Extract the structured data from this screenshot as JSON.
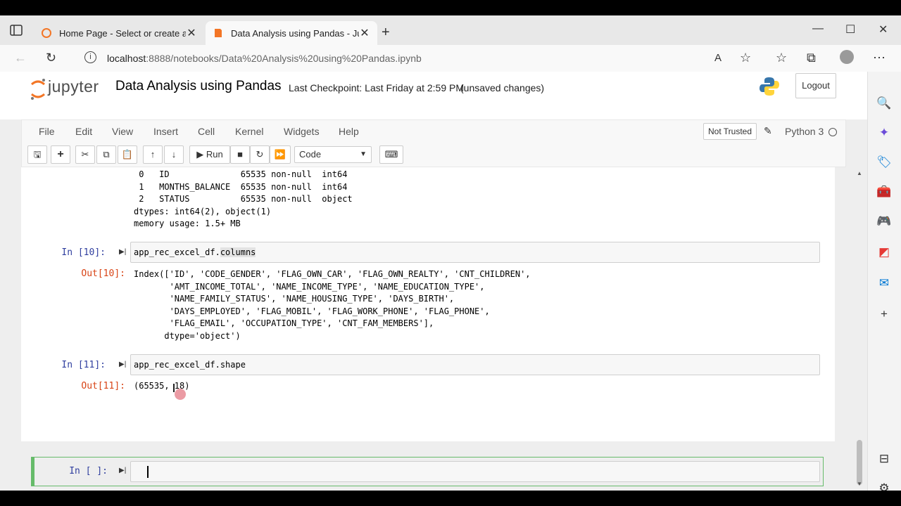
{
  "browser": {
    "tabs": [
      {
        "title": "Home Page - Select or create a notebook",
        "active": false
      },
      {
        "title": "Data Analysis using Pandas - Jupyter Notebook",
        "active": true
      }
    ],
    "url_host": "localhost",
    "url_path": ":8888/notebooks/Data%20Analysis%20using%20Pandas.ipynb"
  },
  "jupyter": {
    "logo_text": "jupyter",
    "notebook_name": "Data Analysis using Pandas",
    "checkpoint": "Last Checkpoint: Last Friday at 2:59 PM",
    "unsaved": "(unsaved changes)",
    "logout": "Logout",
    "menu": [
      "File",
      "Edit",
      "View",
      "Insert",
      "Cell",
      "Kernel",
      "Widgets",
      "Help"
    ],
    "not_trusted": "Not Trusted",
    "kernel": "Python 3",
    "run_label": "Run",
    "cell_type": "Code"
  },
  "cells": {
    "out_info": [
      " 0   ID              65535 non-null  int64",
      " 1   MONTHS_BALANCE  65535 non-null  int64",
      " 2   STATUS          65535 non-null  object",
      "dtypes: int64(2), object(1)",
      "memory usage: 1.5+ MB"
    ],
    "in10_prompt": "In [10]:",
    "in10_code_a": "app_rec_excel_df.",
    "in10_code_b": "columns",
    "out10_prompt": "Out[10]:",
    "out10": [
      "Index(['ID', 'CODE_GENDER', 'FLAG_OWN_CAR', 'FLAG_OWN_REALTY', 'CNT_CHILDREN',",
      "       'AMT_INCOME_TOTAL', 'NAME_INCOME_TYPE', 'NAME_EDUCATION_TYPE',",
      "       'NAME_FAMILY_STATUS', 'NAME_HOUSING_TYPE', 'DAYS_BIRTH',",
      "       'DAYS_EMPLOYED', 'FLAG_MOBIL', 'FLAG_WORK_PHONE', 'FLAG_PHONE',",
      "       'FLAG_EMAIL', 'OCCUPATION_TYPE', 'CNT_FAM_MEMBERS'],",
      "      dtype='object')"
    ],
    "in11_prompt": "In [11]:",
    "in11_code": "app_rec_excel_df.shape",
    "out11_prompt": "Out[11]:",
    "out11": "(65535, 18)",
    "in_empty_prompt": "In [ ]:"
  }
}
